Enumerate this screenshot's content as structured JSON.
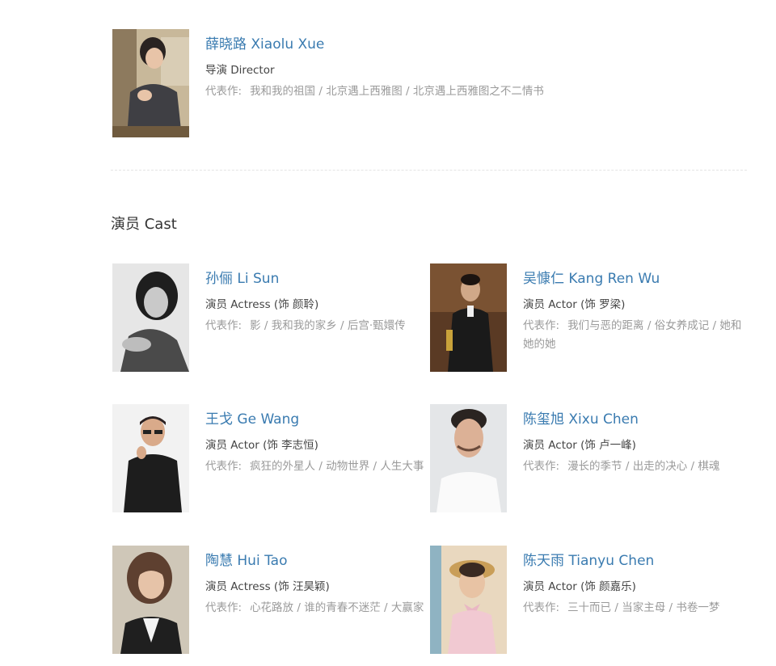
{
  "director": {
    "name": "薛晓路 Xiaolu Xue",
    "role": "导演 Director",
    "works_label": "代表作:",
    "works": "我和我的祖国 / 北京遇上西雅图 / 北京遇上西雅图之不二情书"
  },
  "cast_section": {
    "title": "演员 Cast",
    "works_label": "代表作:"
  },
  "cast": [
    {
      "name": "孙俪 Li Sun",
      "role": "演员 Actress (饰 颜聆)",
      "works": "影 / 我和我的家乡 / 后宫·甄嬛传"
    },
    {
      "name": "吴慷仁 Kang Ren Wu",
      "role": "演员 Actor (饰 罗梁)",
      "works": "我们与恶的距离 / 俗女养成记 / 她和她的她"
    },
    {
      "name": "王戈 Ge Wang",
      "role": "演员 Actor (饰 李志恒)",
      "works": "疯狂的外星人 / 动物世界 / 人生大事"
    },
    {
      "name": "陈玺旭 Xixu Chen",
      "role": "演员 Actor (饰 卢一峰)",
      "works": "漫长的季节 / 出走的决心 / 棋魂"
    },
    {
      "name": "陶慧 Hui Tao",
      "role": "演员 Actress (饰 汪昊颖)",
      "works": "心花路放 / 谁的青春不迷茫 / 大赢家"
    },
    {
      "name": "陈天雨 Tianyu Chen",
      "role": "演员 Actor (饰 颜嘉乐)",
      "works": "三十而已 / 当家主母 / 书卷一梦"
    }
  ]
}
